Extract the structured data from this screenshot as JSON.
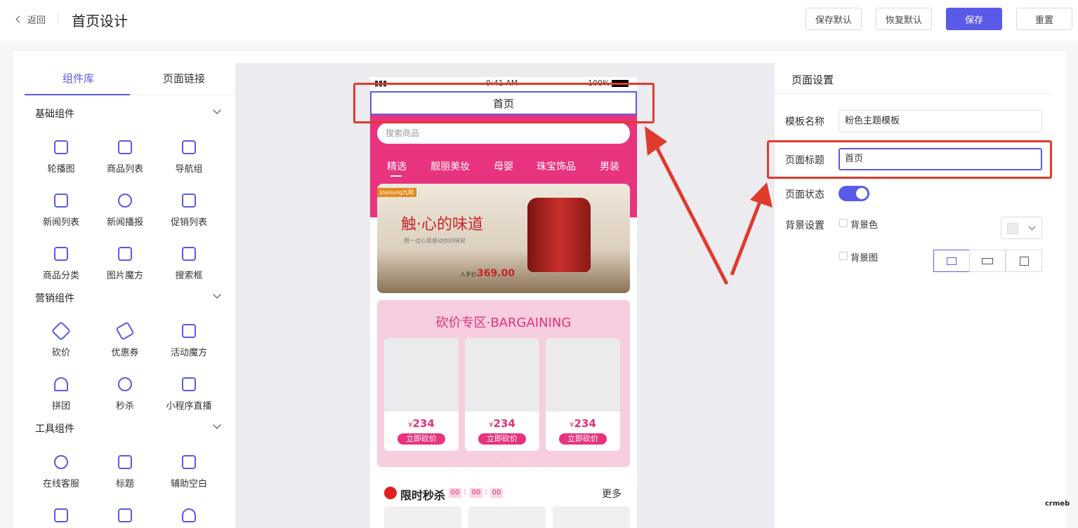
{
  "header": {
    "back": "返回",
    "title": "首页设计",
    "buttons": [
      "保存默认",
      "恢复默认",
      "保存",
      "重置"
    ]
  },
  "left": {
    "tabs": [
      "组件库",
      "页面链接"
    ],
    "sections": [
      {
        "title": "基础组件",
        "items": [
          "轮播图",
          "商品列表",
          "导航组",
          "新闻列表",
          "新闻播报",
          "促销列表",
          "商品分类",
          "图片魔方",
          "搜索框"
        ]
      },
      {
        "title": "营销组件",
        "items": [
          "砍价",
          "优惠券",
          "活动魔方",
          "拼团",
          "秒杀",
          "小程序直播"
        ]
      },
      {
        "title": "工具组件",
        "items": [
          "在线客服",
          "标题",
          "辅助空白"
        ]
      }
    ]
  },
  "phone": {
    "status": {
      "time": "9:41 AM",
      "battery": "100%"
    },
    "nav_title": "首页",
    "search_placeholder": "搜索商品",
    "tabs": [
      "精选",
      "靓丽美妆",
      "母婴",
      "珠宝饰品",
      "男装"
    ],
    "banner": {
      "brand": "Joyoung九阳",
      "headline": "触·心的味道",
      "sub": "用一点心思感动你的味觉",
      "price_label": "入手价:",
      "price": "369.00"
    },
    "bargain": {
      "title": "砍价专区·BARGAINING",
      "currency": "¥",
      "price": "234",
      "button": "立即砍价"
    },
    "flash": {
      "title": "限时秒杀",
      "countdown": [
        "00",
        "00",
        "00"
      ],
      "more": "更多"
    }
  },
  "right": {
    "title": "页面设置",
    "template_name_label": "模板名称",
    "template_name": "粉色主题模板",
    "page_title_label": "页面标题",
    "page_title": "首页",
    "page_status_label": "页面状态",
    "bg_label": "背景设置",
    "bg_color": "背景色",
    "bg_image": "背景图"
  },
  "colors": {
    "accent": "#5a5ae8",
    "pink": "#e8337e",
    "annotation": "#e03a2c"
  },
  "logo": "crmeb"
}
